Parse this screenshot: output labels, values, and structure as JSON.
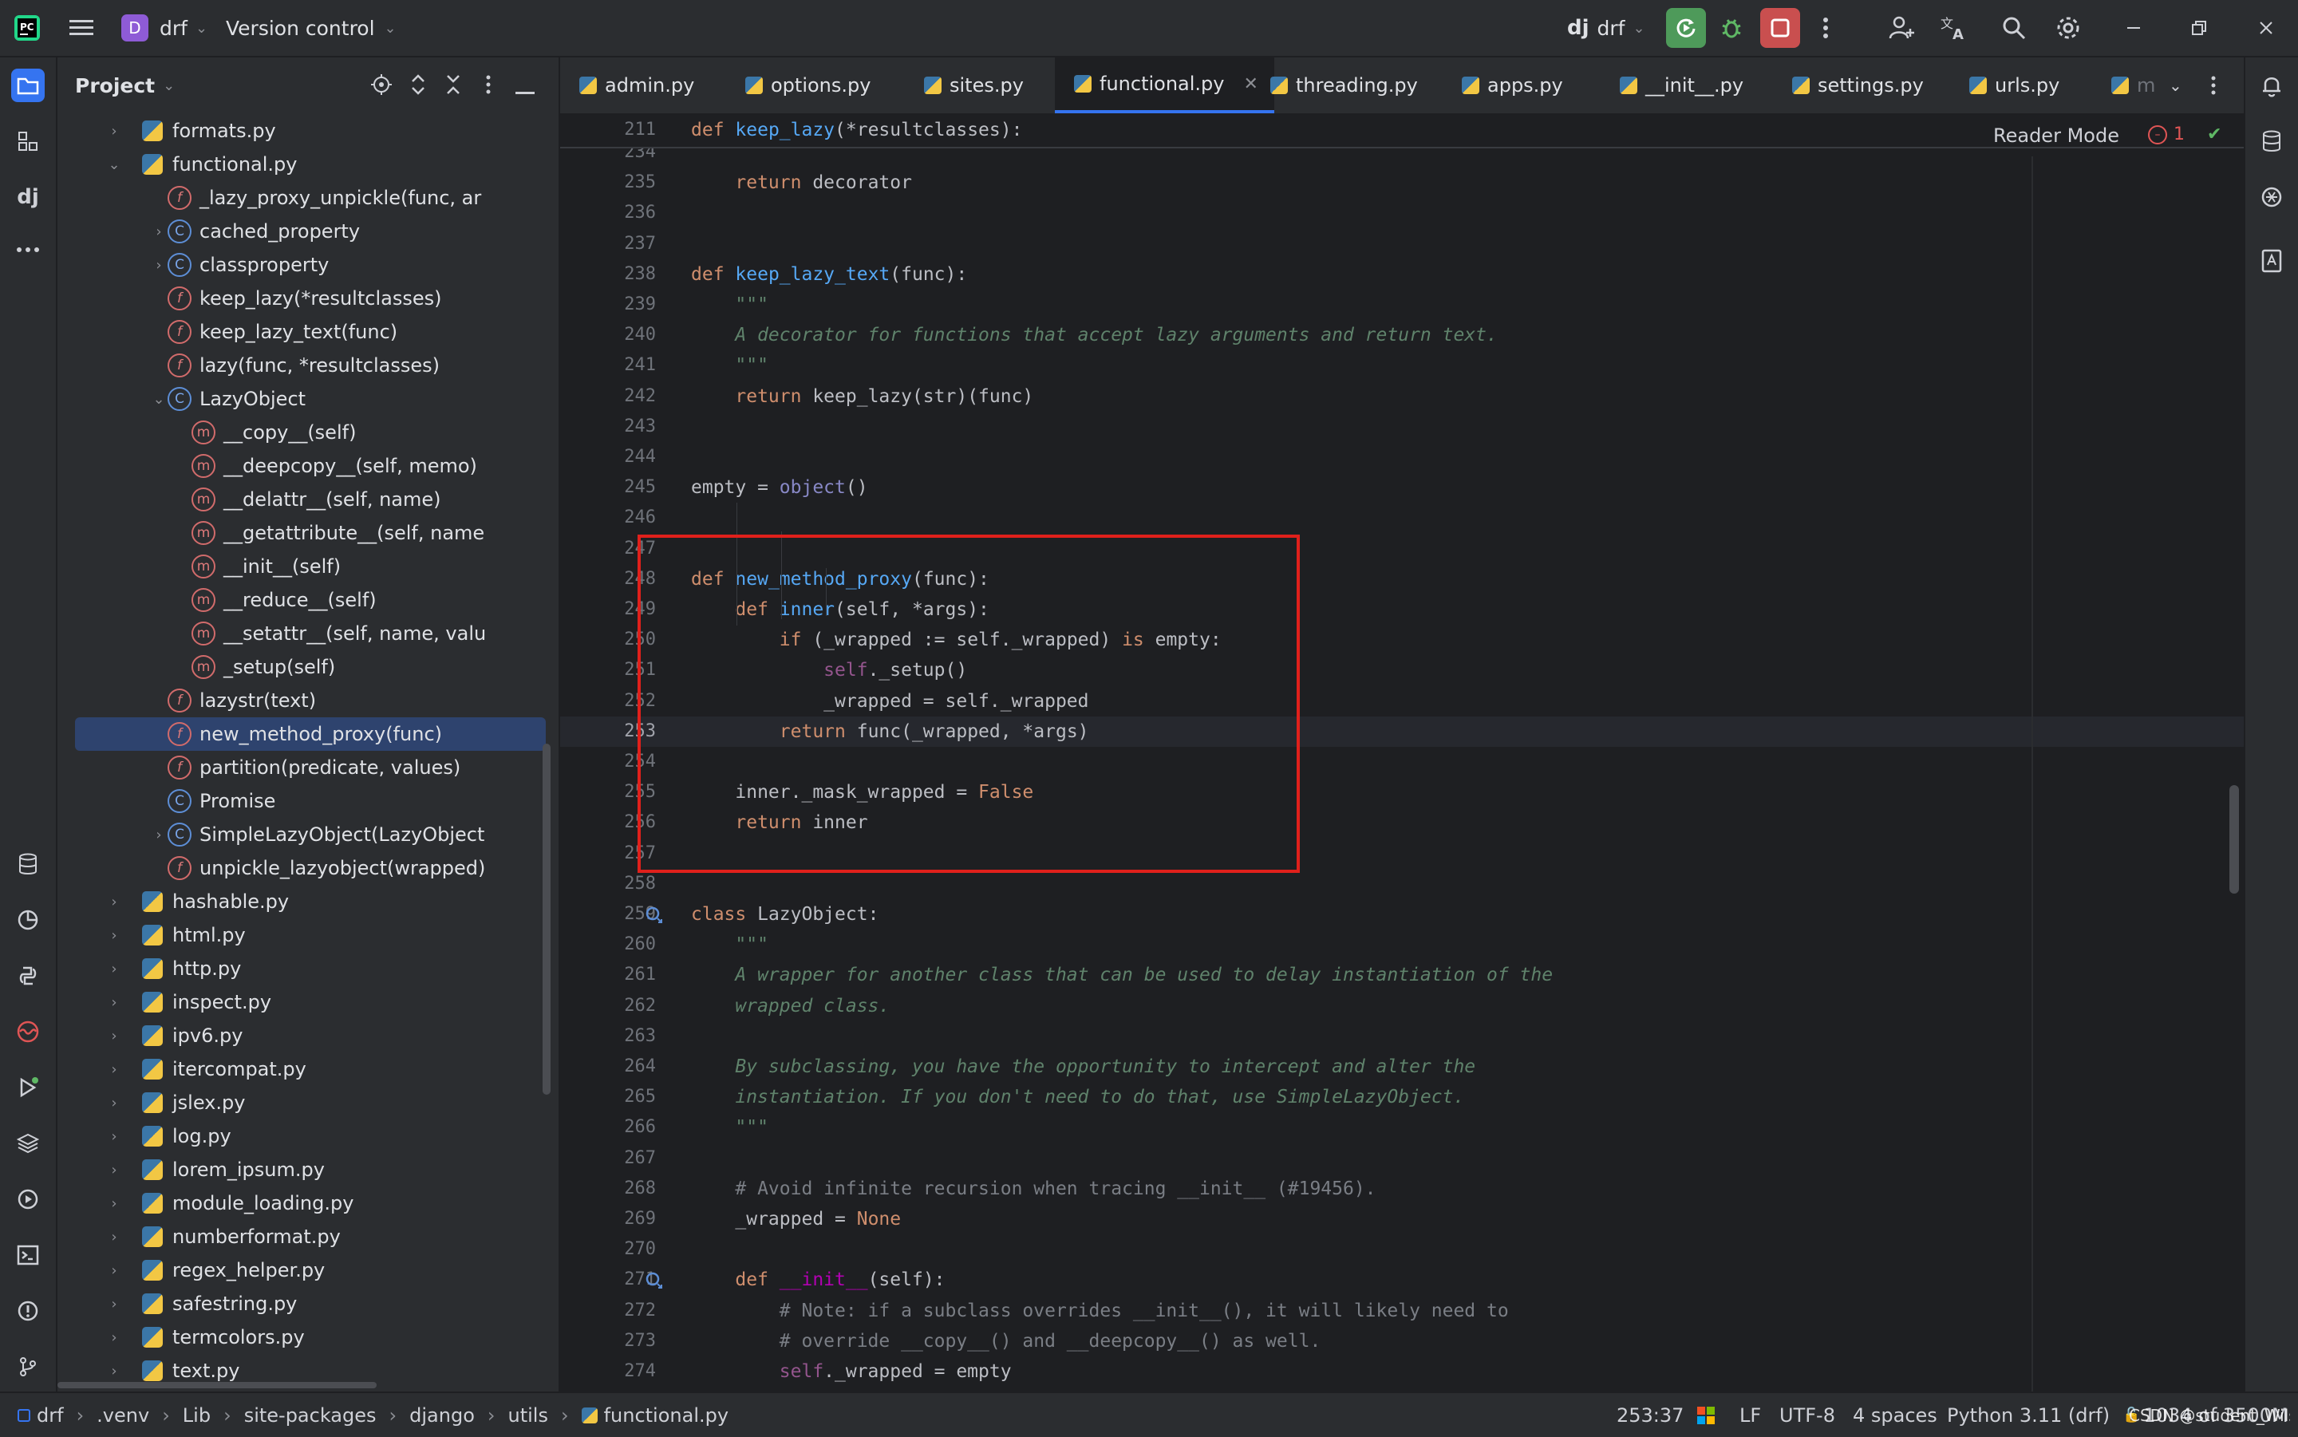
{
  "titlebar": {
    "project_badge": "D",
    "project_name": "drf",
    "vcs_label": "Version control",
    "run_config": "drf"
  },
  "project_panel": {
    "title": "Project",
    "tree": [
      {
        "label": "formats.py",
        "kind": "py",
        "level": 0,
        "arrow": "right"
      },
      {
        "label": "functional.py",
        "kind": "py",
        "level": 0,
        "arrow": "down"
      },
      {
        "label": "_lazy_proxy_unpickle(func, ar",
        "kind": "f",
        "level": 1,
        "arrow": ""
      },
      {
        "label": "cached_property",
        "kind": "c",
        "level": 1,
        "arrow": "right"
      },
      {
        "label": "classproperty",
        "kind": "c",
        "level": 1,
        "arrow": "right"
      },
      {
        "label": "keep_lazy(*resultclasses)",
        "kind": "f",
        "level": 1,
        "arrow": ""
      },
      {
        "label": "keep_lazy_text(func)",
        "kind": "f",
        "level": 1,
        "arrow": ""
      },
      {
        "label": "lazy(func, *resultclasses)",
        "kind": "f",
        "level": 1,
        "arrow": ""
      },
      {
        "label": "LazyObject",
        "kind": "c",
        "level": 1,
        "arrow": "down"
      },
      {
        "label": "__copy__(self)",
        "kind": "m",
        "level": 2,
        "arrow": ""
      },
      {
        "label": "__deepcopy__(self, memo)",
        "kind": "m",
        "level": 2,
        "arrow": ""
      },
      {
        "label": "__delattr__(self, name)",
        "kind": "m",
        "level": 2,
        "arrow": ""
      },
      {
        "label": "__getattribute__(self, name",
        "kind": "m",
        "level": 2,
        "arrow": ""
      },
      {
        "label": "__init__(self)",
        "kind": "m",
        "level": 2,
        "arrow": ""
      },
      {
        "label": "__reduce__(self)",
        "kind": "m",
        "level": 2,
        "arrow": ""
      },
      {
        "label": "__setattr__(self, name, valu",
        "kind": "m",
        "level": 2,
        "arrow": ""
      },
      {
        "label": "_setup(self)",
        "kind": "m",
        "level": 2,
        "arrow": ""
      },
      {
        "label": "lazystr(text)",
        "kind": "f",
        "level": 1,
        "arrow": ""
      },
      {
        "label": "new_method_proxy(func)",
        "kind": "f",
        "level": 1,
        "arrow": "",
        "selected": true
      },
      {
        "label": "partition(predicate, values)",
        "kind": "f",
        "level": 1,
        "arrow": ""
      },
      {
        "label": "Promise",
        "kind": "c",
        "level": 1,
        "arrow": ""
      },
      {
        "label": "SimpleLazyObject(LazyObject",
        "kind": "c",
        "level": 1,
        "arrow": "right"
      },
      {
        "label": "unpickle_lazyobject(wrapped)",
        "kind": "f",
        "level": 1,
        "arrow": ""
      },
      {
        "label": "hashable.py",
        "kind": "py",
        "level": 0,
        "arrow": "right"
      },
      {
        "label": "html.py",
        "kind": "py",
        "level": 0,
        "arrow": "right"
      },
      {
        "label": "http.py",
        "kind": "py",
        "level": 0,
        "arrow": "right"
      },
      {
        "label": "inspect.py",
        "kind": "py",
        "level": 0,
        "arrow": "right"
      },
      {
        "label": "ipv6.py",
        "kind": "py",
        "level": 0,
        "arrow": "right"
      },
      {
        "label": "itercompat.py",
        "kind": "py",
        "level": 0,
        "arrow": "right"
      },
      {
        "label": "jslex.py",
        "kind": "py",
        "level": 0,
        "arrow": "right"
      },
      {
        "label": "log.py",
        "kind": "py",
        "level": 0,
        "arrow": "right"
      },
      {
        "label": "lorem_ipsum.py",
        "kind": "py",
        "level": 0,
        "arrow": "right"
      },
      {
        "label": "module_loading.py",
        "kind": "py",
        "level": 0,
        "arrow": "right"
      },
      {
        "label": "numberformat.py",
        "kind": "py",
        "level": 0,
        "arrow": "right"
      },
      {
        "label": "regex_helper.py",
        "kind": "py",
        "level": 0,
        "arrow": "right"
      },
      {
        "label": "safestring.py",
        "kind": "py",
        "level": 0,
        "arrow": "right"
      },
      {
        "label": "termcolors.py",
        "kind": "py",
        "level": 0,
        "arrow": "right"
      },
      {
        "label": "text.py",
        "kind": "py",
        "level": 0,
        "arrow": "right"
      }
    ]
  },
  "tabs": [
    {
      "label": "admin.py"
    },
    {
      "label": "options.py"
    },
    {
      "label": "sites.py"
    },
    {
      "label": "functional.py",
      "active": true
    },
    {
      "label": "threading.py"
    },
    {
      "label": "apps.py"
    },
    {
      "label": "__init__.py"
    },
    {
      "label": "settings.py"
    },
    {
      "label": "urls.py"
    },
    {
      "label": "m"
    }
  ],
  "editor": {
    "reader_mode": "Reader Mode",
    "error_count": "1",
    "sticky_line": {
      "num": "211",
      "text": "def keep_lazy(*resultclasses):"
    },
    "lines": [
      {
        "num": "234",
        "text": ""
      },
      {
        "num": "235",
        "text": "    return decorator"
      },
      {
        "num": "236",
        "text": ""
      },
      {
        "num": "237",
        "text": ""
      },
      {
        "num": "238",
        "text": "def keep_lazy_text(func):"
      },
      {
        "num": "239",
        "text": "    \"\"\""
      },
      {
        "num": "240",
        "text": "    A decorator for functions that accept lazy arguments and return text."
      },
      {
        "num": "241",
        "text": "    \"\"\""
      },
      {
        "num": "242",
        "text": "    return keep_lazy(str)(func)"
      },
      {
        "num": "243",
        "text": ""
      },
      {
        "num": "244",
        "text": ""
      },
      {
        "num": "245",
        "text": "empty = object()"
      },
      {
        "num": "246",
        "text": ""
      },
      {
        "num": "247",
        "text": ""
      },
      {
        "num": "248",
        "text": "def new_method_proxy(func):"
      },
      {
        "num": "249",
        "text": "    def inner(self, *args):"
      },
      {
        "num": "250",
        "text": "        if (_wrapped := self._wrapped) is empty:"
      },
      {
        "num": "251",
        "text": "            self._setup()"
      },
      {
        "num": "252",
        "text": "            _wrapped = self._wrapped"
      },
      {
        "num": "253",
        "text": "        return func(_wrapped, *args)"
      },
      {
        "num": "254",
        "text": ""
      },
      {
        "num": "255",
        "text": "    inner._mask_wrapped = False"
      },
      {
        "num": "256",
        "text": "    return inner"
      },
      {
        "num": "257",
        "text": ""
      },
      {
        "num": "258",
        "text": ""
      },
      {
        "num": "259",
        "text": "class LazyObject:"
      },
      {
        "num": "260",
        "text": "    \"\"\""
      },
      {
        "num": "261",
        "text": "    A wrapper for another class that can be used to delay instantiation of the"
      },
      {
        "num": "262",
        "text": "    wrapped class."
      },
      {
        "num": "263",
        "text": ""
      },
      {
        "num": "264",
        "text": "    By subclassing, you have the opportunity to intercept and alter the"
      },
      {
        "num": "265",
        "text": "    instantiation. If you don't need to do that, use SimpleLazyObject."
      },
      {
        "num": "266",
        "text": "    \"\"\""
      },
      {
        "num": "267",
        "text": ""
      },
      {
        "num": "268",
        "text": "    # Avoid infinite recursion when tracing __init__ (#19456)."
      },
      {
        "num": "269",
        "text": "    _wrapped = None"
      },
      {
        "num": "270",
        "text": ""
      },
      {
        "num": "271",
        "text": "    def __init__(self):"
      },
      {
        "num": "272",
        "text": "        # Note: if a subclass overrides __init__(), it will likely need to"
      },
      {
        "num": "273",
        "text": "        # override __copy__() and __deepcopy__() as well."
      },
      {
        "num": "274",
        "text": "        self._wrapped = empty"
      }
    ]
  },
  "breadcrumb": [
    ".venv",
    "Lib",
    "site-packages",
    "django",
    "utils",
    "functional.py"
  ],
  "breadcrumb_root": "drf",
  "status": {
    "position": "253:37",
    "line_sep": "LF",
    "encoding": "UTF-8",
    "indent": "4 spaces",
    "interpreter": "Python 3.11 (drf)",
    "memory": "1034 of 3500M",
    "watermark": "CSDN @student_Wilson"
  },
  "colors": {
    "accent": "#3574f0",
    "highlight_box": "#e0201b",
    "selection": "#2e436e",
    "badge": "#8e5bd6"
  }
}
